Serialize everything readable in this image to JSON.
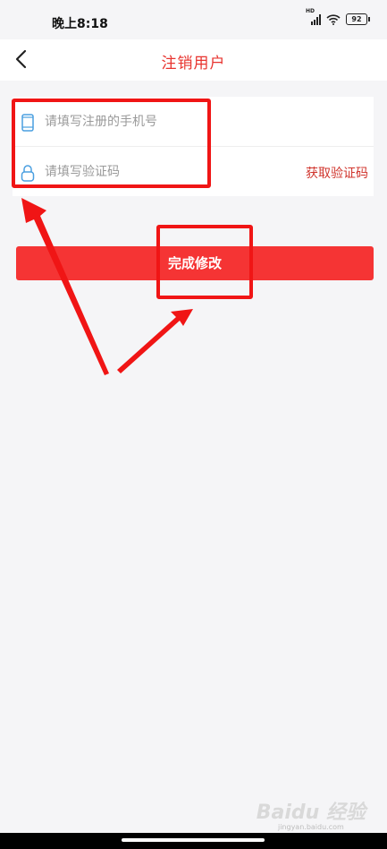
{
  "status_bar": {
    "time": "晚上8:18",
    "network": "HD",
    "battery": "92"
  },
  "header": {
    "title": "注销用户"
  },
  "form": {
    "phone_placeholder": "请填写注册的手机号",
    "phone_value": "",
    "code_placeholder": "请填写验证码",
    "code_value": "",
    "get_code_label": "获取验证码"
  },
  "submit_label": "完成修改",
  "watermark": {
    "logo_text": "Baidu 经验",
    "url": "jingyan.baidu.com"
  },
  "colors": {
    "accent": "#e8342f",
    "button": "#f53434",
    "annotation": "#f01515"
  },
  "icons": {
    "back": "chevron-left-icon",
    "phone": "phone-icon",
    "lock": "lock-icon",
    "signal": "signal-icon",
    "wifi": "wifi-icon",
    "battery": "battery-icon"
  }
}
